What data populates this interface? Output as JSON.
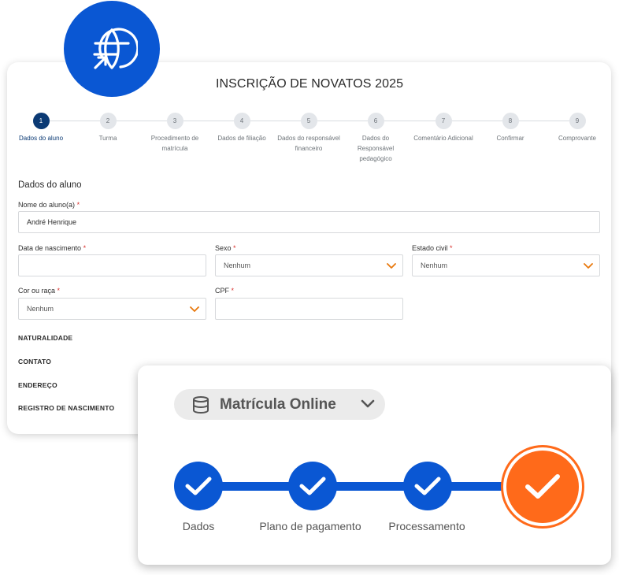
{
  "form": {
    "title": "INSCRIÇÃO DE NOVATOS 2025",
    "steps": [
      {
        "num": "1",
        "label": "Dados do aluno"
      },
      {
        "num": "2",
        "label": "Turma"
      },
      {
        "num": "3",
        "label": "Procedimento de matrícula"
      },
      {
        "num": "4",
        "label": "Dados de filiação"
      },
      {
        "num": "5",
        "label": "Dados do responsável financeiro"
      },
      {
        "num": "6",
        "label": "Dados do Responsável pedagógico"
      },
      {
        "num": "7",
        "label": "Comentário Adicional"
      },
      {
        "num": "8",
        "label": "Confirmar"
      },
      {
        "num": "9",
        "label": "Comprovante"
      }
    ],
    "active_step": "1",
    "section_title": "Dados do aluno",
    "required_mark": "*",
    "fields": {
      "nome": {
        "label": "Nome do aluno(a)",
        "value": "André Henrique"
      },
      "nascimento": {
        "label": "Data de nascimento",
        "value": ""
      },
      "sexo": {
        "label": "Sexo",
        "value": "Nenhum"
      },
      "estado_civil": {
        "label": "Estado civil",
        "value": "Nenhum"
      },
      "cor_raca": {
        "label": "Cor ou raça",
        "value": "Nenhum"
      },
      "cpf": {
        "label": "CPF",
        "value": ""
      }
    },
    "groups": [
      "NATURALIDADE",
      "CONTATO",
      "ENDEREÇO",
      "REGISTRO DE NASCIMENTO"
    ]
  },
  "overlay": {
    "dropdown_label": "Matrícula Online",
    "steps": [
      "Dados",
      "Plano de pagamento",
      "Processamento"
    ]
  },
  "colors": {
    "primary_blue": "#0a57d3",
    "active_step": "#0b3a74",
    "accent_orange": "#ff6a1a",
    "chevron_orange": "#e8780c",
    "required_red": "#d9302c"
  },
  "icons": {
    "globe": "globe-arrow-icon",
    "database": "database-icon",
    "chevron": "chevron-down-icon",
    "check": "check-icon"
  }
}
